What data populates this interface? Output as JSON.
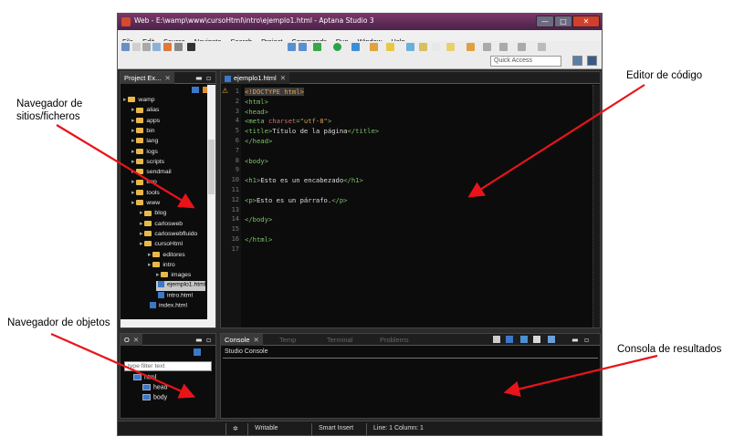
{
  "annotations": {
    "site_navigator": "Navegador de sitios/ficheros",
    "object_navigator": "Navegador de objetos",
    "code_editor": "Editor de código",
    "results_console": "Consola de resultados"
  },
  "window": {
    "title": "Web - E:\\wamp\\www\\cursoHtml\\intro\\ejemplo1.html - Aptana Studio 3",
    "buttons": {
      "minimize": "—",
      "maximize": "□",
      "close": "✕"
    }
  },
  "menu": [
    "File",
    "Edit",
    "Source",
    "Navigate",
    "Search",
    "Project",
    "Commands",
    "Run",
    "Window",
    "Help"
  ],
  "quick_access": {
    "placeholder": "Quick Access"
  },
  "project_explorer": {
    "tab": "Project Ex...",
    "tree": [
      {
        "label": "wamp",
        "depth": 0,
        "kind": "folder"
      },
      {
        "label": "alias",
        "depth": 1,
        "kind": "folder"
      },
      {
        "label": "apps",
        "depth": 1,
        "kind": "folder"
      },
      {
        "label": "bin",
        "depth": 1,
        "kind": "folder"
      },
      {
        "label": "lang",
        "depth": 1,
        "kind": "folder"
      },
      {
        "label": "logs",
        "depth": 1,
        "kind": "folder"
      },
      {
        "label": "scripts",
        "depth": 1,
        "kind": "folder"
      },
      {
        "label": "sendmail",
        "depth": 1,
        "kind": "folder"
      },
      {
        "label": "tmp",
        "depth": 1,
        "kind": "folder"
      },
      {
        "label": "tools",
        "depth": 1,
        "kind": "folder"
      },
      {
        "label": "www",
        "depth": 1,
        "kind": "folder"
      },
      {
        "label": "blog",
        "depth": 2,
        "kind": "folder"
      },
      {
        "label": "carlosweb",
        "depth": 2,
        "kind": "folder"
      },
      {
        "label": "carloswebfluido",
        "depth": 2,
        "kind": "folder"
      },
      {
        "label": "cursoHtml",
        "depth": 2,
        "kind": "folder"
      },
      {
        "label": "editores",
        "depth": 3,
        "kind": "folder"
      },
      {
        "label": "intro",
        "depth": 3,
        "kind": "folder"
      },
      {
        "label": "images",
        "depth": 4,
        "kind": "folder"
      },
      {
        "label": "ejemplo1.html",
        "depth": 4,
        "kind": "file",
        "selected": true
      },
      {
        "label": "intro.html",
        "depth": 4,
        "kind": "file"
      },
      {
        "label": "index.html",
        "depth": 3,
        "kind": "file"
      }
    ]
  },
  "editor": {
    "tab": "ejemplo1.html",
    "lines": [
      {
        "n": "1",
        "html": "<span>&lt;!DOCTYPE html&gt;</span>"
      },
      {
        "n": "2",
        "html": "<span class='c-tag'>&lt;html&gt;</span>"
      },
      {
        "n": "3",
        "html": "<span class='c-tag'>&lt;head&gt;</span>"
      },
      {
        "n": "4",
        "html": "<span class='c-tag'>&lt;meta </span><span class='c-attr'>charset</span><span class='c-tag'>=</span><span class='c-str'>\"utf-8\"</span><span class='c-tag'>&gt;</span>"
      },
      {
        "n": "5",
        "html": "<span class='c-tag'>&lt;title&gt;</span><span class='c-txt'>Título de la página</span><span class='c-tag'>&lt;/title&gt;</span>"
      },
      {
        "n": "6",
        "html": "<span class='c-tag'>&lt;/head&gt;</span>"
      },
      {
        "n": "7",
        "html": ""
      },
      {
        "n": "8",
        "html": "<span class='c-tag'>&lt;body&gt;</span>"
      },
      {
        "n": "9",
        "html": ""
      },
      {
        "n": "10",
        "html": "<span class='c-tag'>&lt;h1&gt;</span><span class='c-txt'>Esto es un encabezado</span><span class='c-tag'>&lt;/h1&gt;</span>"
      },
      {
        "n": "11",
        "html": ""
      },
      {
        "n": "12",
        "html": "<span class='c-tag'>&lt;p&gt;</span><span class='c-txt'>Esto es un párrafo.</span><span class='c-tag'>&lt;/p&gt;</span>"
      },
      {
        "n": "13",
        "html": ""
      },
      {
        "n": "14",
        "html": "<span class='c-tag'>&lt;/body&gt;</span>"
      },
      {
        "n": "15",
        "html": ""
      },
      {
        "n": "16",
        "html": "<span class='c-tag'>&lt;/html&gt;</span>"
      },
      {
        "n": "17",
        "html": ""
      }
    ]
  },
  "outline": {
    "tab": "O",
    "filter_placeholder": "type filter text",
    "items": [
      {
        "label": "html",
        "depth": 0
      },
      {
        "label": "head",
        "depth": 1
      },
      {
        "label": "body",
        "depth": 1
      }
    ]
  },
  "console": {
    "tabs": [
      "Console",
      "Temp",
      "Terminal",
      "Problems"
    ],
    "header": "Studio Console"
  },
  "status": {
    "writable": "Writable",
    "insert": "Smart Insert",
    "position": "Line: 1 Column: 1"
  }
}
